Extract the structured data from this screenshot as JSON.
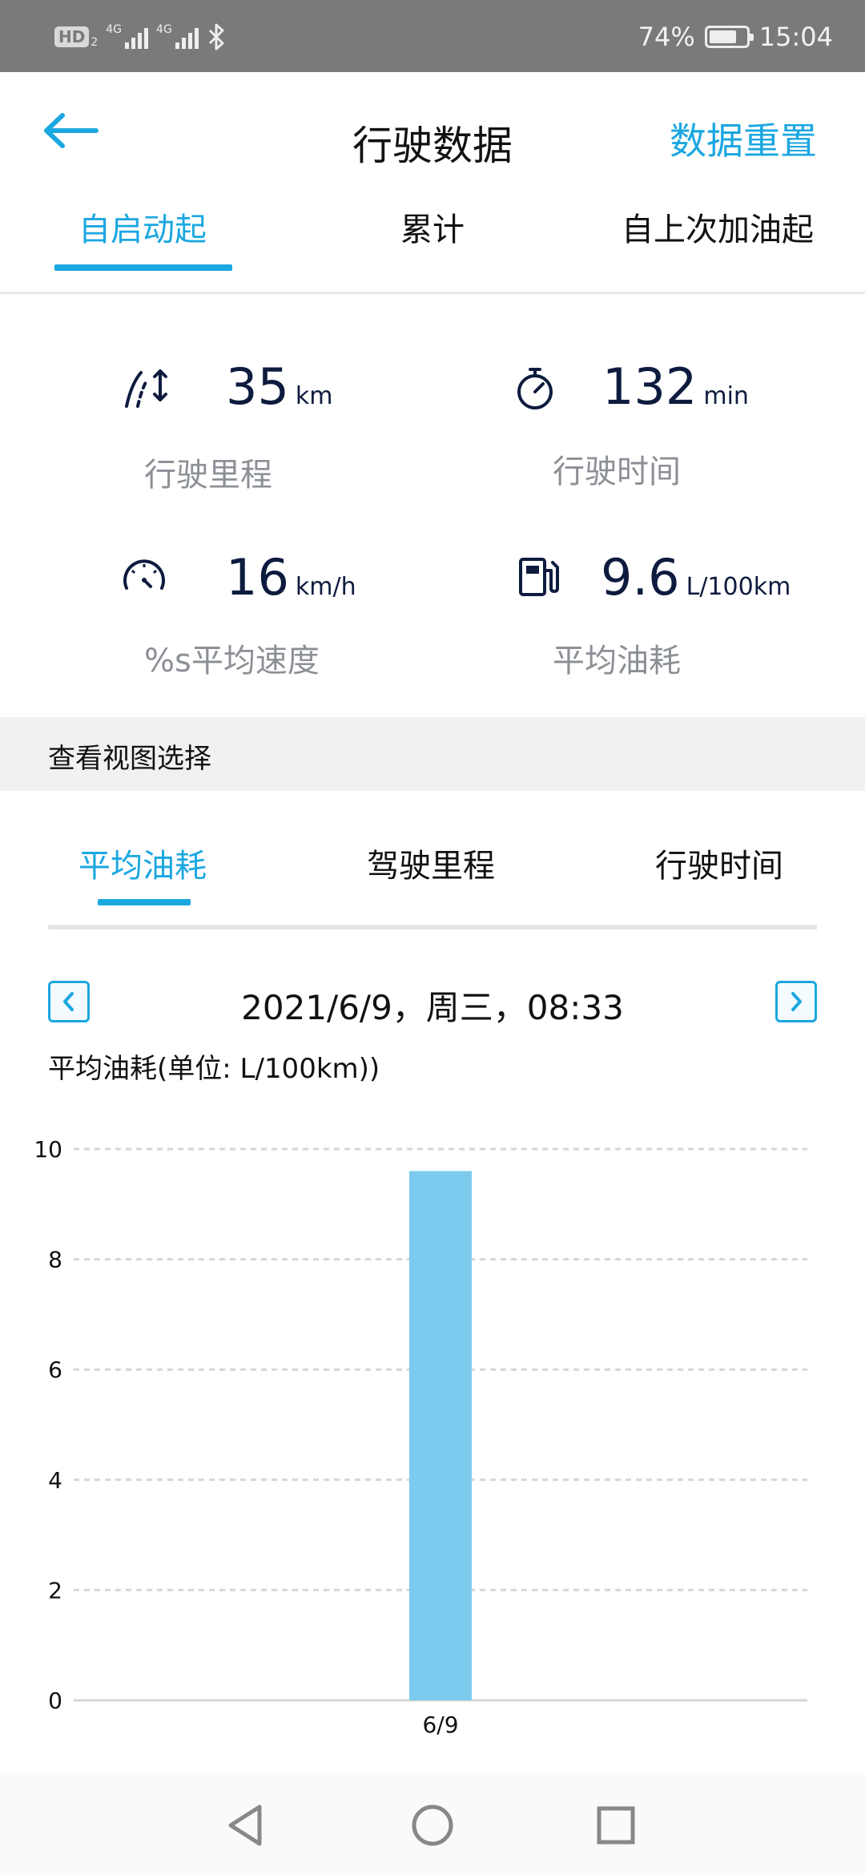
{
  "status_bar": {
    "hd_label": "HD",
    "hd_sub": "2",
    "network1": "4G",
    "network2": "4G",
    "battery_percent_text": "74%",
    "battery_level": 0.74,
    "time": "15:04"
  },
  "header": {
    "title": "行驶数据",
    "reset_label": "数据重置",
    "back_icon": "arrow-left-icon"
  },
  "top_tabs": [
    {
      "label": "自启动起",
      "active": true
    },
    {
      "label": "累计",
      "active": false
    },
    {
      "label": "自上次加油起",
      "active": false
    }
  ],
  "stats": {
    "distance": {
      "value": "35",
      "unit": "km",
      "label": "行驶里程",
      "icon": "road-icon"
    },
    "duration": {
      "value": "132",
      "unit": "min",
      "label": "行驶时间",
      "icon": "stopwatch-icon"
    },
    "speed": {
      "value": "16",
      "unit": "km/h",
      "label": "%s平均速度",
      "icon": "speedometer-icon"
    },
    "consumption": {
      "value": "9.6",
      "unit": "L/100km",
      "label": "平均油耗",
      "icon": "fuel-pump-icon"
    }
  },
  "view_section": {
    "title": "查看视图选择",
    "tabs": [
      {
        "label": "平均油耗",
        "active": true
      },
      {
        "label": "驾驶里程",
        "active": false
      },
      {
        "label": "行驶时间",
        "active": false
      }
    ]
  },
  "date_nav": {
    "date_text": "2021/6/9，周三，08:33",
    "prev_icon": "chevron-left-icon",
    "next_icon": "chevron-right-icon"
  },
  "chart_subtitle": "平均油耗(单位: L/100km))",
  "chart_data": {
    "type": "bar",
    "categories": [
      "6/9"
    ],
    "values": [
      9.6
    ],
    "ylim": [
      0,
      10
    ],
    "yticks": [
      "0",
      "2",
      "4",
      "6",
      "8",
      "10"
    ],
    "grid": true,
    "bar_color": "#7ccbee"
  },
  "colors": {
    "accent": "#1ba7e0",
    "value_text": "#0d1b3e",
    "label_text": "#8c9096",
    "status_bar": "#7a7a7a"
  },
  "nav_bar": {
    "back_icon": "triangle-back-icon",
    "home_icon": "circle-home-icon",
    "recents_icon": "square-recents-icon"
  }
}
